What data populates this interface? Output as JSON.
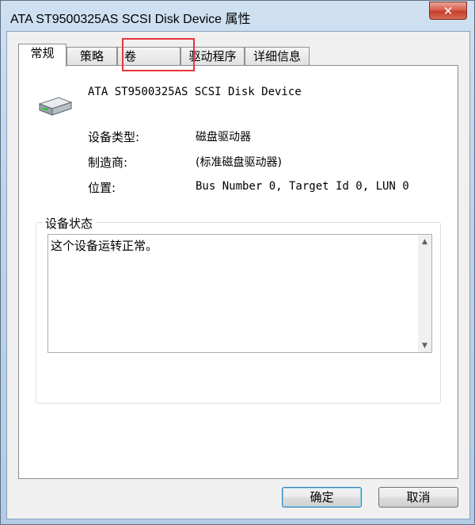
{
  "window": {
    "title": "ATA ST9500325AS SCSI Disk Device 属性",
    "close_symbol": "✕"
  },
  "tabs": [
    {
      "label": "常规",
      "active": true
    },
    {
      "label": "策略",
      "active": false
    },
    {
      "label": "卷",
      "active": false
    },
    {
      "label": "驱动程序",
      "active": false
    },
    {
      "label": "详细信息",
      "active": false
    }
  ],
  "general": {
    "device_icon": "hard-drive-icon",
    "device_name": "ATA ST9500325AS SCSI Disk Device",
    "properties": [
      {
        "label": "设备类型:",
        "value": "磁盘驱动器"
      },
      {
        "label": "制造商:",
        "value": "(标准磁盘驱动器)"
      },
      {
        "label": "位置:",
        "value": "Bus Number 0, Target Id 0, LUN 0"
      }
    ],
    "status_group_title": "设备状态",
    "status_text": "这个设备运转正常。"
  },
  "buttons": {
    "ok": "确定",
    "cancel": "取消"
  },
  "colors": {
    "highlight": "#e5363b",
    "close_button": "#c53f2a"
  }
}
